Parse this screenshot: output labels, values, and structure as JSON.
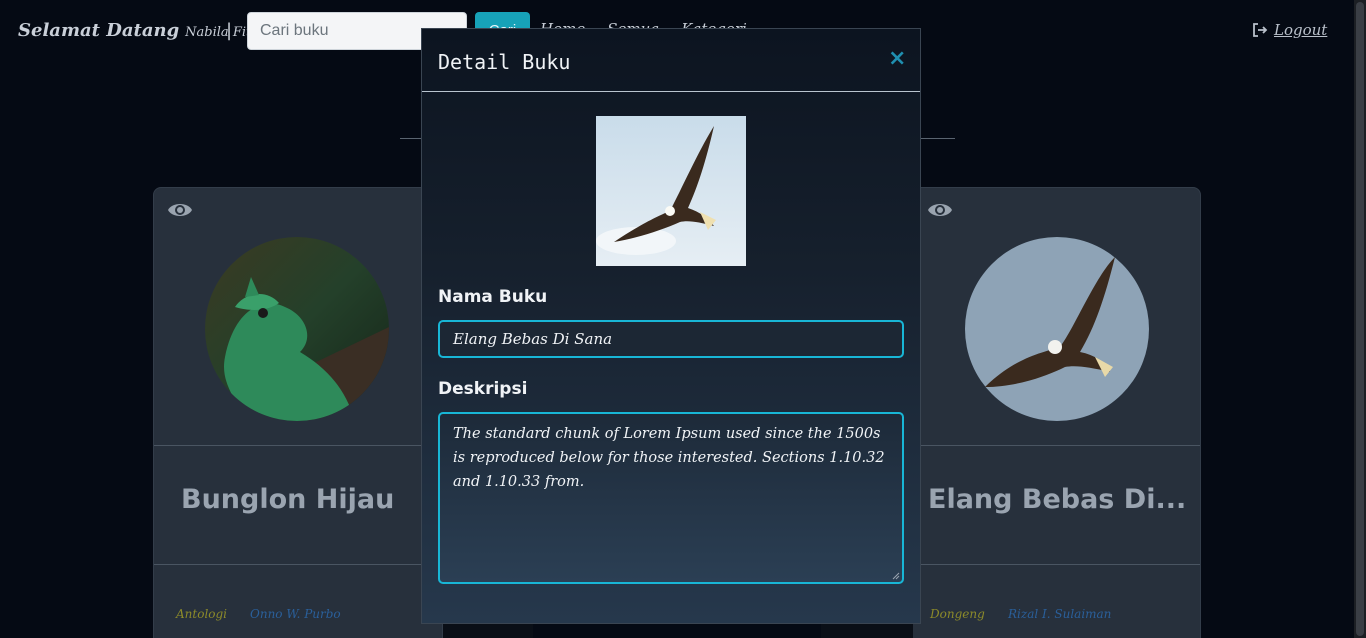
{
  "nav": {
    "brand_greeting": "Selamat Datang",
    "brand_user": "Nabila Fitriani",
    "separator": "|",
    "search_placeholder": "Cari buku",
    "search_button": "Cari",
    "links": [
      "Home",
      "Semua",
      "Kategori"
    ],
    "logout": "Logout"
  },
  "cards": [
    {
      "title": "Bunglon Hijau",
      "tag": "Antologi",
      "author": "Onno W. Purbo"
    },
    {
      "title": "Elang Bebas Di...",
      "tag": "Dongeng",
      "author": "Rizal I. Sulaiman"
    }
  ],
  "modal": {
    "title": "Detail Buku",
    "close": "×",
    "name_label": "Nama Buku",
    "name_value": "Elang Bebas Di Sana",
    "desc_label": "Deskripsi",
    "desc_value": "The standard chunk of Lorem Ipsum used since the 1500s is reproduced below for those interested. Sections 1.10.32 and 1.10.33 from."
  },
  "colors": {
    "accent": "#17a2b8",
    "input_border": "#18b6d6",
    "tag": "#8c8a2a",
    "author": "#2a5f9a"
  },
  "icons": {
    "view": "eye-icon",
    "logout": "sign-out-icon",
    "close": "close-icon"
  }
}
